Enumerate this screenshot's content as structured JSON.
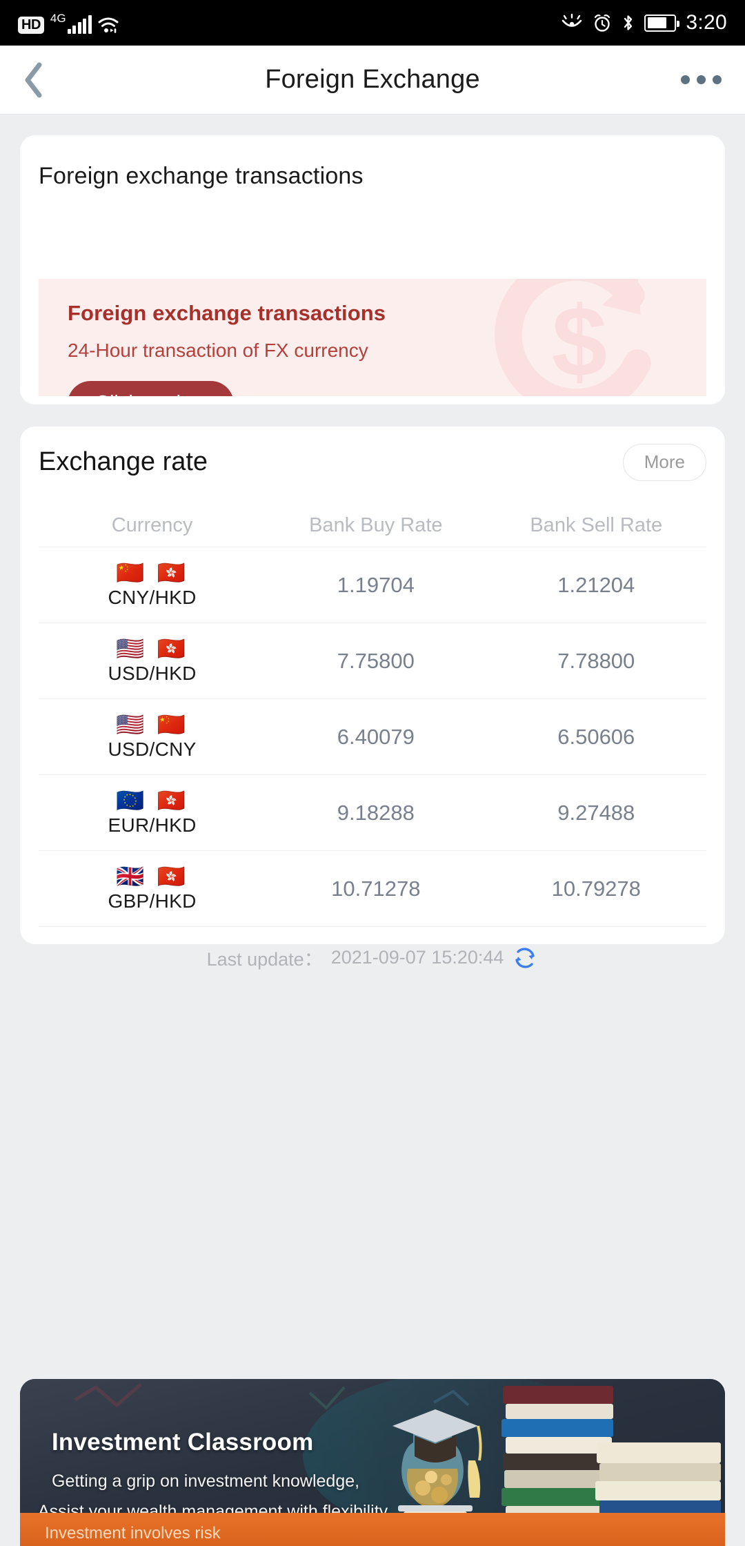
{
  "statusbar": {
    "hd": "HD",
    "network": "4G",
    "time": "3:20",
    "icons": [
      "hd-badge",
      "signal-bars-icon",
      "wifi-icon",
      "eye-care-icon",
      "alarm-icon",
      "bluetooth-icon",
      "battery-icon"
    ]
  },
  "navbar": {
    "title": "Foreign Exchange",
    "back": "back-arrow",
    "overflow": "more-options"
  },
  "fx_card": {
    "title": "Foreign exchange transactions",
    "promo": {
      "heading": "Foreign exchange transactions",
      "subtitle": "24-Hour transaction of FX currency",
      "button": "Click to view",
      "accent": "#a3393a",
      "bg": "#fdeeee"
    }
  },
  "rate_card": {
    "title": "Exchange rate",
    "more_label": "More",
    "columns": [
      "Currency",
      "Bank Buy Rate",
      "Bank Sell Rate"
    ],
    "rows": [
      {
        "pair": "CNY/HKD",
        "flags": "🇨🇳 🇭🇰",
        "buy": "1.19704",
        "sell": "1.21204"
      },
      {
        "pair": "USD/HKD",
        "flags": "🇺🇸 🇭🇰",
        "buy": "7.75800",
        "sell": "7.78800"
      },
      {
        "pair": "USD/CNY",
        "flags": "🇺🇸 🇨🇳",
        "buy": "6.40079",
        "sell": "6.50606"
      },
      {
        "pair": "EUR/HKD",
        "flags": "🇪🇺 🇭🇰",
        "buy": "9.18288",
        "sell": "9.27488"
      },
      {
        "pair": "GBP/HKD",
        "flags": "🇬🇧 🇭🇰",
        "buy": "10.71278",
        "sell": "10.79278"
      }
    ],
    "last_update_label": "Last update：",
    "last_update_time": "2021-09-07 15:20:44",
    "refresh_icon": "refresh-icon",
    "refresh_color": "#3b7ef0"
  },
  "edu_banner": {
    "title": "Investment Classroom",
    "line1": "Getting a grip on investment knowledge,",
    "line2": "Assist your wealth management with flexibility.",
    "risk": "Investment involves risk"
  }
}
